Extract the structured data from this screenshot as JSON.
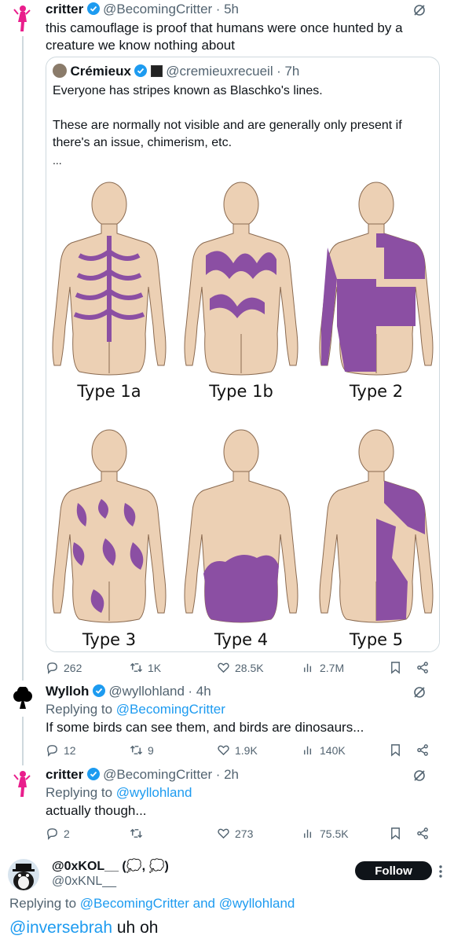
{
  "tweet1": {
    "name": "critter",
    "handle": "@BecomingCritter",
    "time": "· 5h",
    "text": "this camouflage is proof that humans were once hunted by a creature we know nothing about",
    "quote": {
      "name": "Crémieux",
      "handle": "@cremieuxrecueil",
      "time": "· 7h",
      "line1": "Everyone has stripes known as Blaschko's lines.",
      "line2": "These are normally not visible and are generally only present if there's an issue, chimerism, etc.",
      "ellipsis": "...",
      "figure_labels": [
        "Type 1a",
        "Type 1b",
        "Type 2",
        "Type 3",
        "Type 4",
        "Type 5"
      ]
    },
    "stats": {
      "replies": "262",
      "retweets": "1K",
      "likes": "28.5K",
      "views": "2.7M"
    }
  },
  "tweet2": {
    "name": "Wylloh",
    "handle": "@wyllohland",
    "time": "· 4h",
    "replying_prefix": "Replying to ",
    "replying_to": "@BecomingCritter",
    "text": "If some birds can see them, and birds are dinosaurs...",
    "stats": {
      "replies": "12",
      "retweets": "9",
      "likes": "1.9K",
      "views": "140K"
    }
  },
  "tweet3": {
    "name": "critter",
    "handle": "@BecomingCritter",
    "time": "· 2h",
    "replying_prefix": "Replying to ",
    "replying_to": "@wyllohland",
    "text": "actually though...",
    "stats": {
      "replies": "2",
      "retweets": "",
      "likes": "273",
      "views": "75.5K"
    }
  },
  "tweet4": {
    "name": "@0xKOL__ (💭, 💭)",
    "handle": "@0xKNL__",
    "follow_label": "Follow",
    "replying_prefix": "Replying to ",
    "replying_to": "@BecomingCritter and @wyllohland",
    "mention": "@inversebrah",
    "text": " uh oh"
  },
  "colors": {
    "accent": "#1d9bf0",
    "stripe": "#8b4fa3",
    "skin": "#ecd0b4",
    "muted": "#536471"
  }
}
